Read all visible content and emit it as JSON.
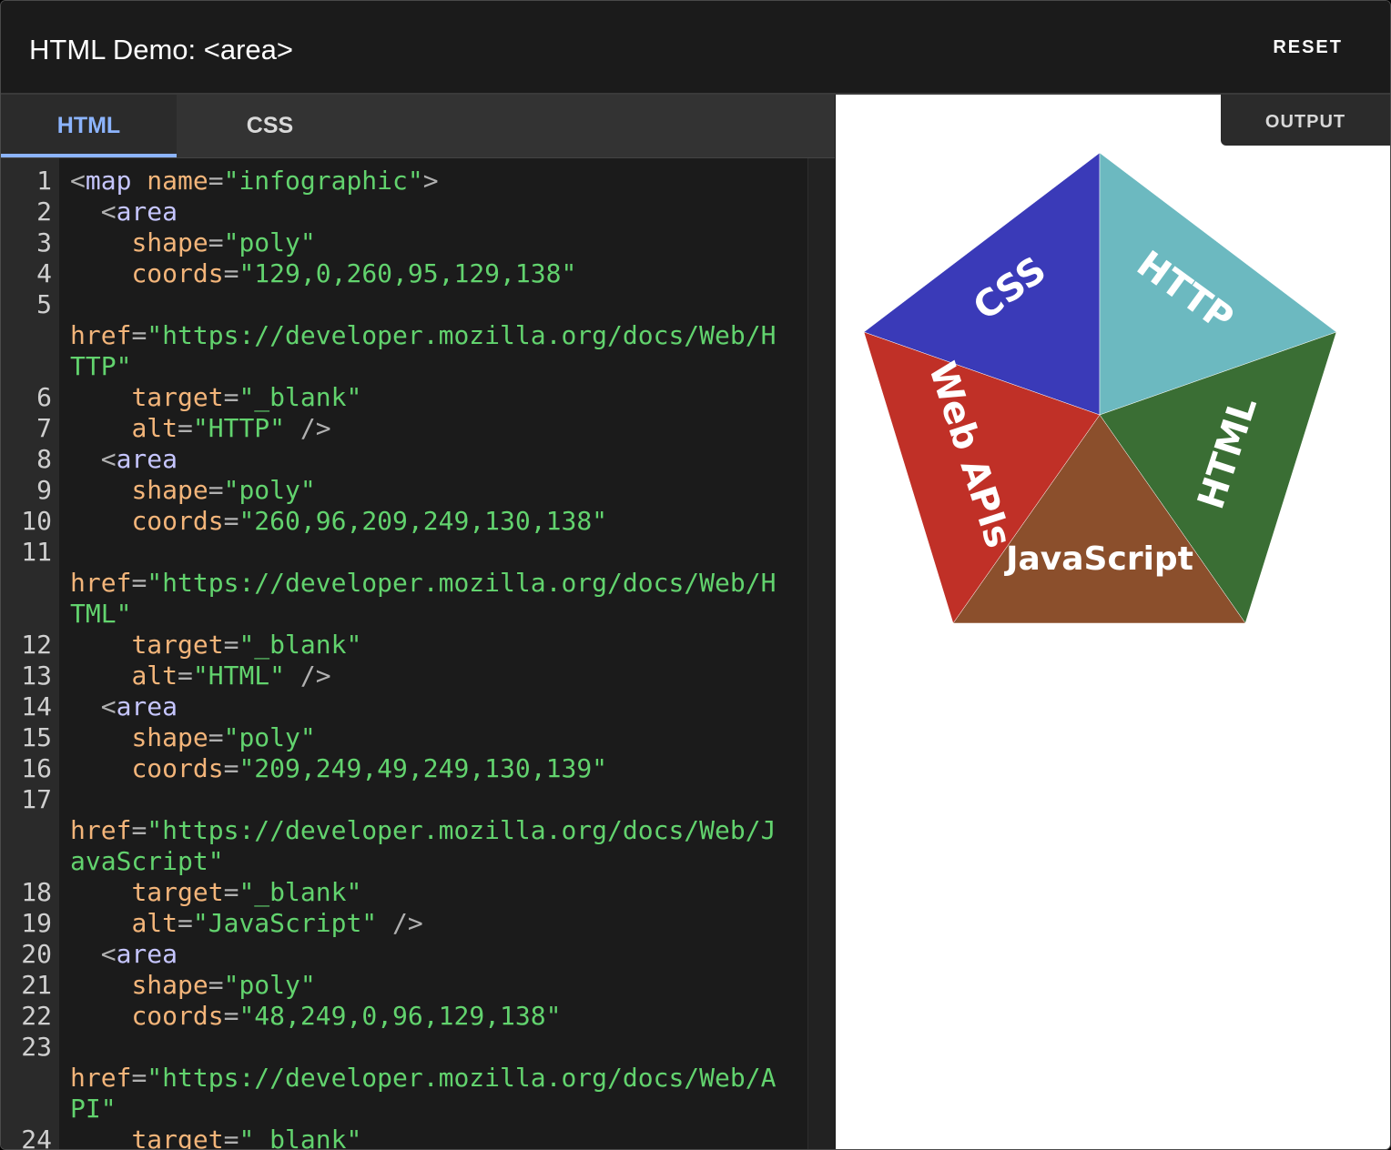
{
  "header": {
    "title": "HTML Demo: <area>",
    "reset_label": "RESET"
  },
  "editor": {
    "tabs": [
      {
        "label": "HTML",
        "active": true
      },
      {
        "label": "CSS",
        "active": false
      }
    ],
    "lines": [
      {
        "num": "1",
        "text": "<map name=\"infographic\">"
      },
      {
        "num": "2",
        "text": "  <area"
      },
      {
        "num": "3",
        "text": "    shape=\"poly\""
      },
      {
        "num": "4",
        "text": "    coords=\"129,0,260,95,129,138\""
      },
      {
        "num": "5",
        "text": ""
      },
      {
        "num": "",
        "text": "href=\"https://developer.mozilla.org/docs/Web/H"
      },
      {
        "num": "",
        "text": "TTP\""
      },
      {
        "num": "6",
        "text": "    target=\"_blank\""
      },
      {
        "num": "7",
        "text": "    alt=\"HTTP\" />"
      },
      {
        "num": "8",
        "text": "  <area"
      },
      {
        "num": "9",
        "text": "    shape=\"poly\""
      },
      {
        "num": "10",
        "text": "    coords=\"260,96,209,249,130,138\""
      },
      {
        "num": "11",
        "text": ""
      },
      {
        "num": "",
        "text": "href=\"https://developer.mozilla.org/docs/Web/H"
      },
      {
        "num": "",
        "text": "TML\""
      },
      {
        "num": "12",
        "text": "    target=\"_blank\""
      },
      {
        "num": "13",
        "text": "    alt=\"HTML\" />"
      },
      {
        "num": "14",
        "text": "  <area"
      },
      {
        "num": "15",
        "text": "    shape=\"poly\""
      },
      {
        "num": "16",
        "text": "    coords=\"209,249,49,249,130,139\""
      },
      {
        "num": "17",
        "text": ""
      },
      {
        "num": "",
        "text": "href=\"https://developer.mozilla.org/docs/Web/J"
      },
      {
        "num": "",
        "text": "avaScript\""
      },
      {
        "num": "18",
        "text": "    target=\"_blank\""
      },
      {
        "num": "19",
        "text": "    alt=\"JavaScript\" />"
      },
      {
        "num": "20",
        "text": "  <area"
      },
      {
        "num": "21",
        "text": "    shape=\"poly\""
      },
      {
        "num": "22",
        "text": "    coords=\"48,249,0,96,129,138\""
      },
      {
        "num": "23",
        "text": ""
      },
      {
        "num": "",
        "text": "href=\"https://developer.mozilla.org/docs/Web/A"
      },
      {
        "num": "",
        "text": "PI\""
      },
      {
        "num": "24",
        "text": "    target=\"_blank\""
      }
    ]
  },
  "output": {
    "tab_label": "OUTPUT",
    "segments": {
      "css": "CSS",
      "http": "HTTP",
      "html": "HTML",
      "javascript": "JavaScript",
      "webapis": "Web APIs"
    },
    "colors": {
      "css": "#3a3ab8",
      "http": "#6cb9c0",
      "html": "#3a6e34",
      "javascript": "#8b4f2c",
      "webapis": "#c03027"
    }
  }
}
